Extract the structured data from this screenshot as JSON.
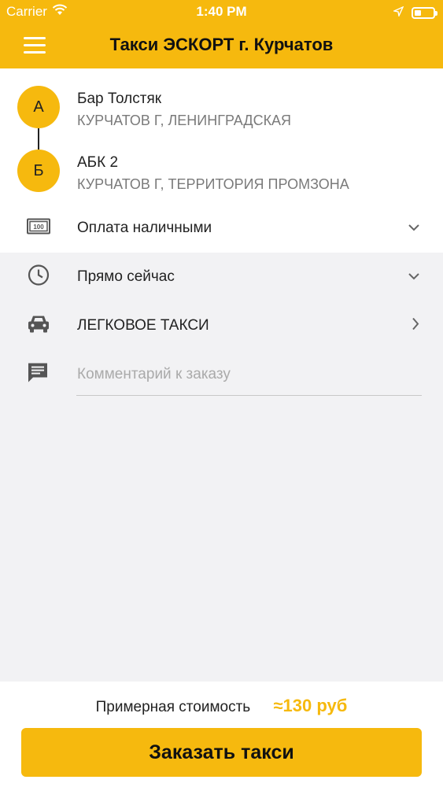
{
  "status_bar": {
    "carrier": "Carrier",
    "time": "1:40 PM",
    "icons": [
      "wifi-icon",
      "location-arrow-icon",
      "battery-icon"
    ]
  },
  "header": {
    "title": "Такси ЭСКОРТ г. Курчатов",
    "menu_icon": "hamburger-menu-icon"
  },
  "route": {
    "from": {
      "marker": "А",
      "name": "Бар Толстяк",
      "address": "КУРЧАТОВ Г, ЛЕНИНГРАДСКАЯ"
    },
    "to": {
      "marker": "Б",
      "name": "АБК 2",
      "address": "КУРЧАТОВ Г, ТЕРРИТОРИЯ ПРОМЗОНА"
    }
  },
  "options": {
    "payment": {
      "label": "Оплата наличными",
      "icon": "cash-icon",
      "chevron": "chevron-down-icon"
    },
    "time": {
      "label": "Прямо сейчас",
      "icon": "clock-icon",
      "chevron": "chevron-down-icon"
    },
    "car": {
      "label": "ЛЕГКОВОЕ ТАКСИ",
      "icon": "car-icon",
      "chevron": "chevron-right-icon"
    },
    "comment": {
      "placeholder": "Комментарий к заказу",
      "icon": "comment-icon"
    }
  },
  "footer": {
    "price_label": "Примерная стоимость",
    "price_value": "≈130 руб",
    "order_button": "Заказать такси"
  },
  "colors": {
    "accent": "#f6b90e",
    "background": "#f2f2f4",
    "text": "#222222",
    "secondary_text": "#7a7a7a"
  }
}
